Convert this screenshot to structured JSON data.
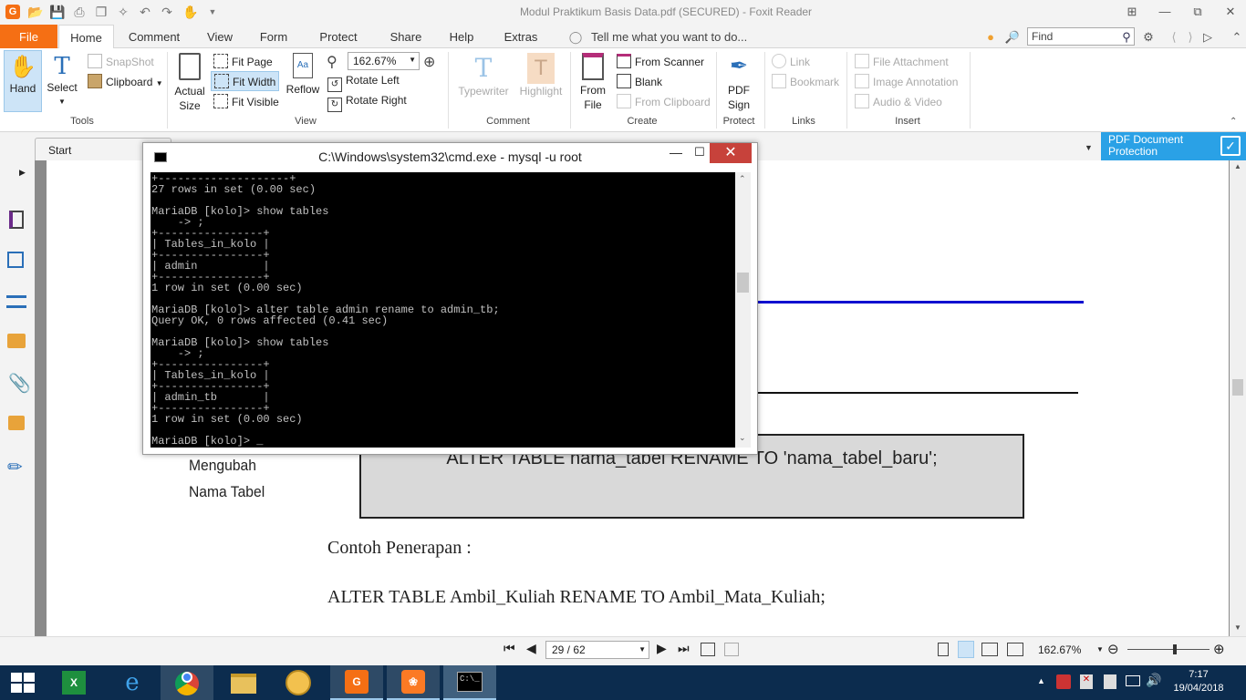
{
  "app": {
    "title": "Modul Praktikum Basis Data.pdf (SECURED) - Foxit Reader"
  },
  "menu": {
    "file": "File",
    "tabs": [
      "Home",
      "Comment",
      "View",
      "Form",
      "Protect",
      "Share",
      "Help",
      "Extras"
    ],
    "tell_me": "Tell me what you want to do...",
    "find_placeholder": "Find"
  },
  "ribbon": {
    "tools": {
      "hand": "Hand",
      "select": "Select",
      "snapshot": "SnapShot",
      "clipboard": "Clipboard",
      "label": "Tools"
    },
    "view": {
      "actual_size_1": "Actual",
      "actual_size_2": "Size",
      "fit_page": "Fit Page",
      "fit_width": "Fit Width",
      "fit_visible": "Fit Visible",
      "reflow": "Reflow",
      "zoom": "162.67%",
      "rotate_left": "Rotate Left",
      "rotate_right": "Rotate Right",
      "label": "View"
    },
    "comment": {
      "typewriter": "Typewriter",
      "highlight": "Highlight",
      "label": "Comment"
    },
    "create": {
      "from_file_1": "From",
      "from_file_2": "File",
      "from_scanner": "From Scanner",
      "blank": "Blank",
      "from_clipboard": "From Clipboard",
      "label": "Create"
    },
    "protect": {
      "pdf_sign_1": "PDF",
      "pdf_sign_2": "Sign",
      "label": "Protect"
    },
    "links": {
      "link": "Link",
      "bookmark": "Bookmark",
      "label": "Links"
    },
    "insert": {
      "file_attachment": "File Attachment",
      "image_annotation": "Image Annotation",
      "audio_video": "Audio & Video",
      "label": "Insert"
    }
  },
  "doc_tabs": {
    "start": "Start",
    "pdf_protection_1": "PDF Document",
    "pdf_protection_2": "Protection"
  },
  "cmd": {
    "title": "C:\\Windows\\system32\\cmd.exe - mysql  -u root",
    "lines": "+--------------------+\n27 rows in set (0.00 sec)\n\nMariaDB [kolo]> show tables\n    -> ;\n+----------------+\n| Tables_in_kolo |\n+----------------+\n| admin          |\n+----------------+\n1 row in set (0.00 sec)\n\nMariaDB [kolo]> alter table admin rename to admin_tb;\nQuery OK, 0 rows affected (0.41 sec)\n\nMariaDB [kolo]> show tables\n    -> ;\n+----------------+\n| Tables_in_kolo |\n+----------------+\n| admin_tb       |\n+----------------+\n1 row in set (0.00 sec)\n\nMariaDB [kolo]> _"
  },
  "document": {
    "side_label_1": "Mengubah",
    "side_label_2": "Nama Tabel",
    "syntax": "ALTER TABLE  nama_tabel  RENAME TO 'nama_tabel_baru';",
    "example_heading": "Contoh Penerapan :",
    "example": "ALTER TABLE Ambil_Kuliah RENAME TO Ambil_Mata_Kuliah;"
  },
  "status": {
    "page": "29 / 62",
    "zoom": "162.67%"
  },
  "tray": {
    "time": "7:17",
    "date": "19/04/2018"
  },
  "colors": {
    "accent": "#f56f14",
    "taskbar": "#0c2c4e",
    "protect_banner": "#2aa1e6",
    "close": "#c7423b"
  }
}
